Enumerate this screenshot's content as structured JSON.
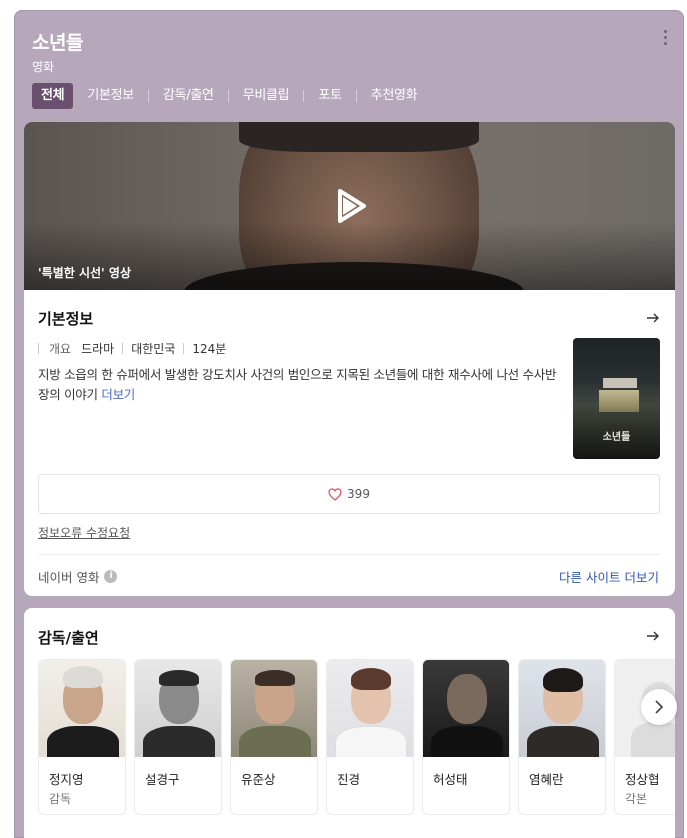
{
  "header": {
    "title": "소년들",
    "subtitle": "영화",
    "tabs": [
      {
        "label": "전체",
        "active": true
      },
      {
        "label": "기본정보"
      },
      {
        "label": "감독/출연"
      },
      {
        "label": "무비클립"
      },
      {
        "label": "포토"
      },
      {
        "label": "추천영화"
      }
    ]
  },
  "video": {
    "caption": "'특별한 시선' 영상"
  },
  "basic_info": {
    "title": "기본정보",
    "meta_label": "개요",
    "genre": "드라마",
    "country": "대한민국",
    "runtime": "124분",
    "synopsis": "지방 소읍의 한 슈퍼에서 발생한 강도치사 사건의 범인으로 지목된 소년들에 대한 재수사에 나선 수사반장의 이야기",
    "more_link": "더보기",
    "poster_title": "소년들",
    "like_count": "399",
    "report_link": "정보오류 수정요청",
    "source_label": "네이버 영화",
    "source_info_icon": "i",
    "other_sites_link": "다른 사이트 더보기"
  },
  "cast_section": {
    "title": "감독/출연",
    "people": [
      {
        "name": "정지영",
        "role": "감독"
      },
      {
        "name": "설경구",
        "role": ""
      },
      {
        "name": "유준상",
        "role": ""
      },
      {
        "name": "진경",
        "role": ""
      },
      {
        "name": "허성태",
        "role": ""
      },
      {
        "name": "염혜란",
        "role": ""
      },
      {
        "name": "정상협",
        "role": "각본"
      }
    ]
  },
  "colors": {
    "header_bg": "#b7a7ba",
    "active_tab": "#6b4f6e",
    "link_blue": "#2e58b6",
    "heart": "#e0525b"
  },
  "icons": {
    "kebab": "kebab-menu-icon",
    "play": "play-icon",
    "arrow": "arrow-right-icon",
    "heart": "heart-icon",
    "info": "info-icon",
    "chevron": "chevron-right-icon"
  }
}
